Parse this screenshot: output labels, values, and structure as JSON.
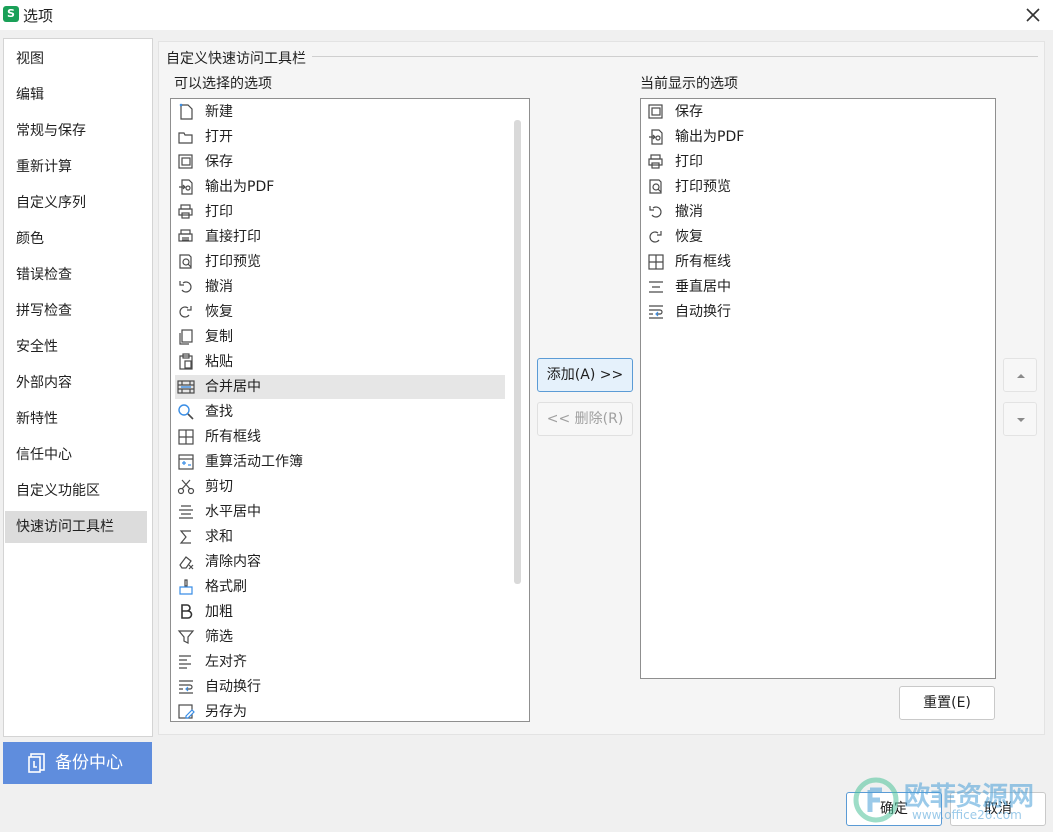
{
  "window": {
    "title": "选项",
    "logo_letter": "S"
  },
  "nav": {
    "items": [
      "视图",
      "编辑",
      "常规与保存",
      "重新计算",
      "自定义序列",
      "颜色",
      "错误检查",
      "拼写检查",
      "安全性",
      "外部内容",
      "新特性",
      "信任中心",
      "自定义功能区",
      "快速访问工具栏"
    ],
    "active_index": 13
  },
  "backup_label": "备份中心",
  "panel": {
    "group_title": "自定义快速访问工具栏",
    "available_label": "可以选择的选项",
    "current_label": "当前显示的选项",
    "available_items": [
      {
        "label": "新建",
        "icon": "new-file-icon"
      },
      {
        "label": "打开",
        "icon": "open-folder-icon"
      },
      {
        "label": "保存",
        "icon": "save-icon"
      },
      {
        "label": "输出为PDF",
        "icon": "export-pdf-icon"
      },
      {
        "label": "打印",
        "icon": "print-icon"
      },
      {
        "label": "直接打印",
        "icon": "direct-print-icon"
      },
      {
        "label": "打印预览",
        "icon": "print-preview-icon"
      },
      {
        "label": "撤消",
        "icon": "undo-icon"
      },
      {
        "label": "恢复",
        "icon": "redo-icon"
      },
      {
        "label": "复制",
        "icon": "copy-icon"
      },
      {
        "label": "粘贴",
        "icon": "paste-icon"
      },
      {
        "label": "合并居中",
        "icon": "merge-center-icon"
      },
      {
        "label": "查找",
        "icon": "search-icon"
      },
      {
        "label": "所有框线",
        "icon": "all-borders-icon"
      },
      {
        "label": "重算活动工作簿",
        "icon": "recalculate-icon"
      },
      {
        "label": "剪切",
        "icon": "scissors-icon"
      },
      {
        "label": "水平居中",
        "icon": "align-center-icon"
      },
      {
        "label": "求和",
        "icon": "sum-icon"
      },
      {
        "label": "清除内容",
        "icon": "eraser-icon"
      },
      {
        "label": "格式刷",
        "icon": "format-painter-icon"
      },
      {
        "label": "加粗",
        "icon": "bold-icon"
      },
      {
        "label": "筛选",
        "icon": "filter-icon"
      },
      {
        "label": "左对齐",
        "icon": "align-left-icon"
      },
      {
        "label": "自动换行",
        "icon": "wrap-text-icon"
      },
      {
        "label": "另存为",
        "icon": "save-as-icon"
      }
    ],
    "available_selected_index": 11,
    "current_items": [
      {
        "label": "保存",
        "icon": "save-icon"
      },
      {
        "label": "输出为PDF",
        "icon": "export-pdf-icon"
      },
      {
        "label": "打印",
        "icon": "print-icon"
      },
      {
        "label": "打印预览",
        "icon": "print-preview-icon"
      },
      {
        "label": "撤消",
        "icon": "undo-icon"
      },
      {
        "label": "恢复",
        "icon": "redo-icon"
      },
      {
        "label": "所有框线",
        "icon": "all-borders-icon"
      },
      {
        "label": "垂直居中",
        "icon": "align-middle-icon"
      },
      {
        "label": "自动换行",
        "icon": "wrap-text-icon"
      }
    ]
  },
  "buttons": {
    "add": "添加(A) >>",
    "remove": "<< 删除(R)",
    "reset": "重置(E)",
    "ok": "确定",
    "cancel": "取消"
  },
  "watermark": {
    "text": "欧菲资源网",
    "url": "www.office26.com"
  }
}
